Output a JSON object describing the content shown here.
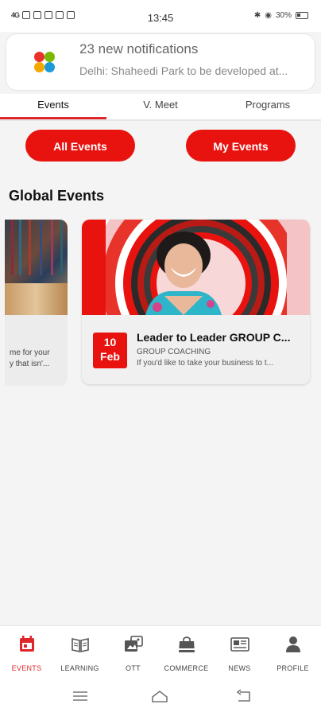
{
  "status_bar": {
    "time": "13:45",
    "signal": "4G",
    "battery": "30%"
  },
  "notification": {
    "title": "23 new notifications",
    "body": "Delhi: Shaheedi Park to be developed at..."
  },
  "tabs": [
    {
      "label": "Events"
    },
    {
      "label": "V. Meet"
    },
    {
      "label": "Programs"
    }
  ],
  "filters": {
    "all_events": "All Events",
    "my_events": "My Events"
  },
  "section": {
    "title": "Global Events"
  },
  "partial_card": {
    "line1": "me for your",
    "line2": "y that isn'..."
  },
  "event_card": {
    "day": "10",
    "month": "Feb",
    "title": "Leader to Leader  GROUP C...",
    "category": "GROUP COACHING",
    "description": "If you'd like to take your business to t..."
  },
  "bottom_nav": [
    {
      "label": "EVENTS",
      "icon": "calendar-icon"
    },
    {
      "label": "LEARNING",
      "icon": "book-icon"
    },
    {
      "label": "OTT",
      "icon": "media-icon"
    },
    {
      "label": "COMMERCE",
      "icon": "shopping-bag-icon"
    },
    {
      "label": "NEWS",
      "icon": "newspaper-icon"
    },
    {
      "label": "PROFILE",
      "icon": "person-icon"
    }
  ],
  "colors": {
    "accent": "#e8130f",
    "tab_underline": "#e0262b"
  }
}
